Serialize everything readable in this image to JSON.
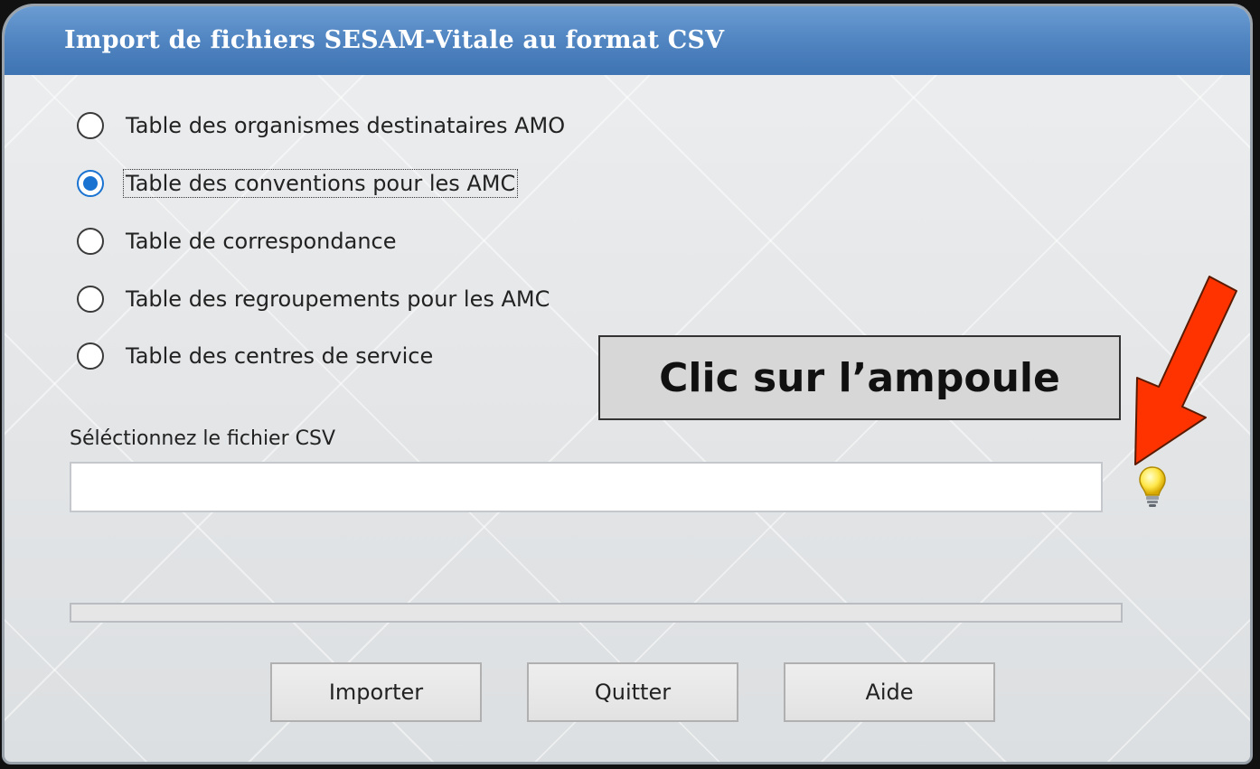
{
  "window": {
    "title": "Import de fichiers SESAM-Vitale au format CSV"
  },
  "options": [
    {
      "label": "Table des organismes destinataires AMO",
      "selected": false
    },
    {
      "label": "Table des conventions pour les AMC",
      "selected": true
    },
    {
      "label": "Table de correspondance",
      "selected": false
    },
    {
      "label": "Table des regroupements pour les AMC",
      "selected": false
    },
    {
      "label": "Table des centres de service",
      "selected": false
    }
  ],
  "file": {
    "label": "Séléctionnez le fichier CSV",
    "value": "",
    "icon": "lightbulb-icon"
  },
  "progress": {
    "value": 0
  },
  "buttons": {
    "import": "Importer",
    "quit": "Quitter",
    "help": "Aide"
  },
  "annotation": {
    "text": "Clic sur l’ampoule",
    "arrow_color": "#ff3300"
  },
  "colors": {
    "titlebar": "#4e83c0",
    "accent": "#1a73d1"
  }
}
